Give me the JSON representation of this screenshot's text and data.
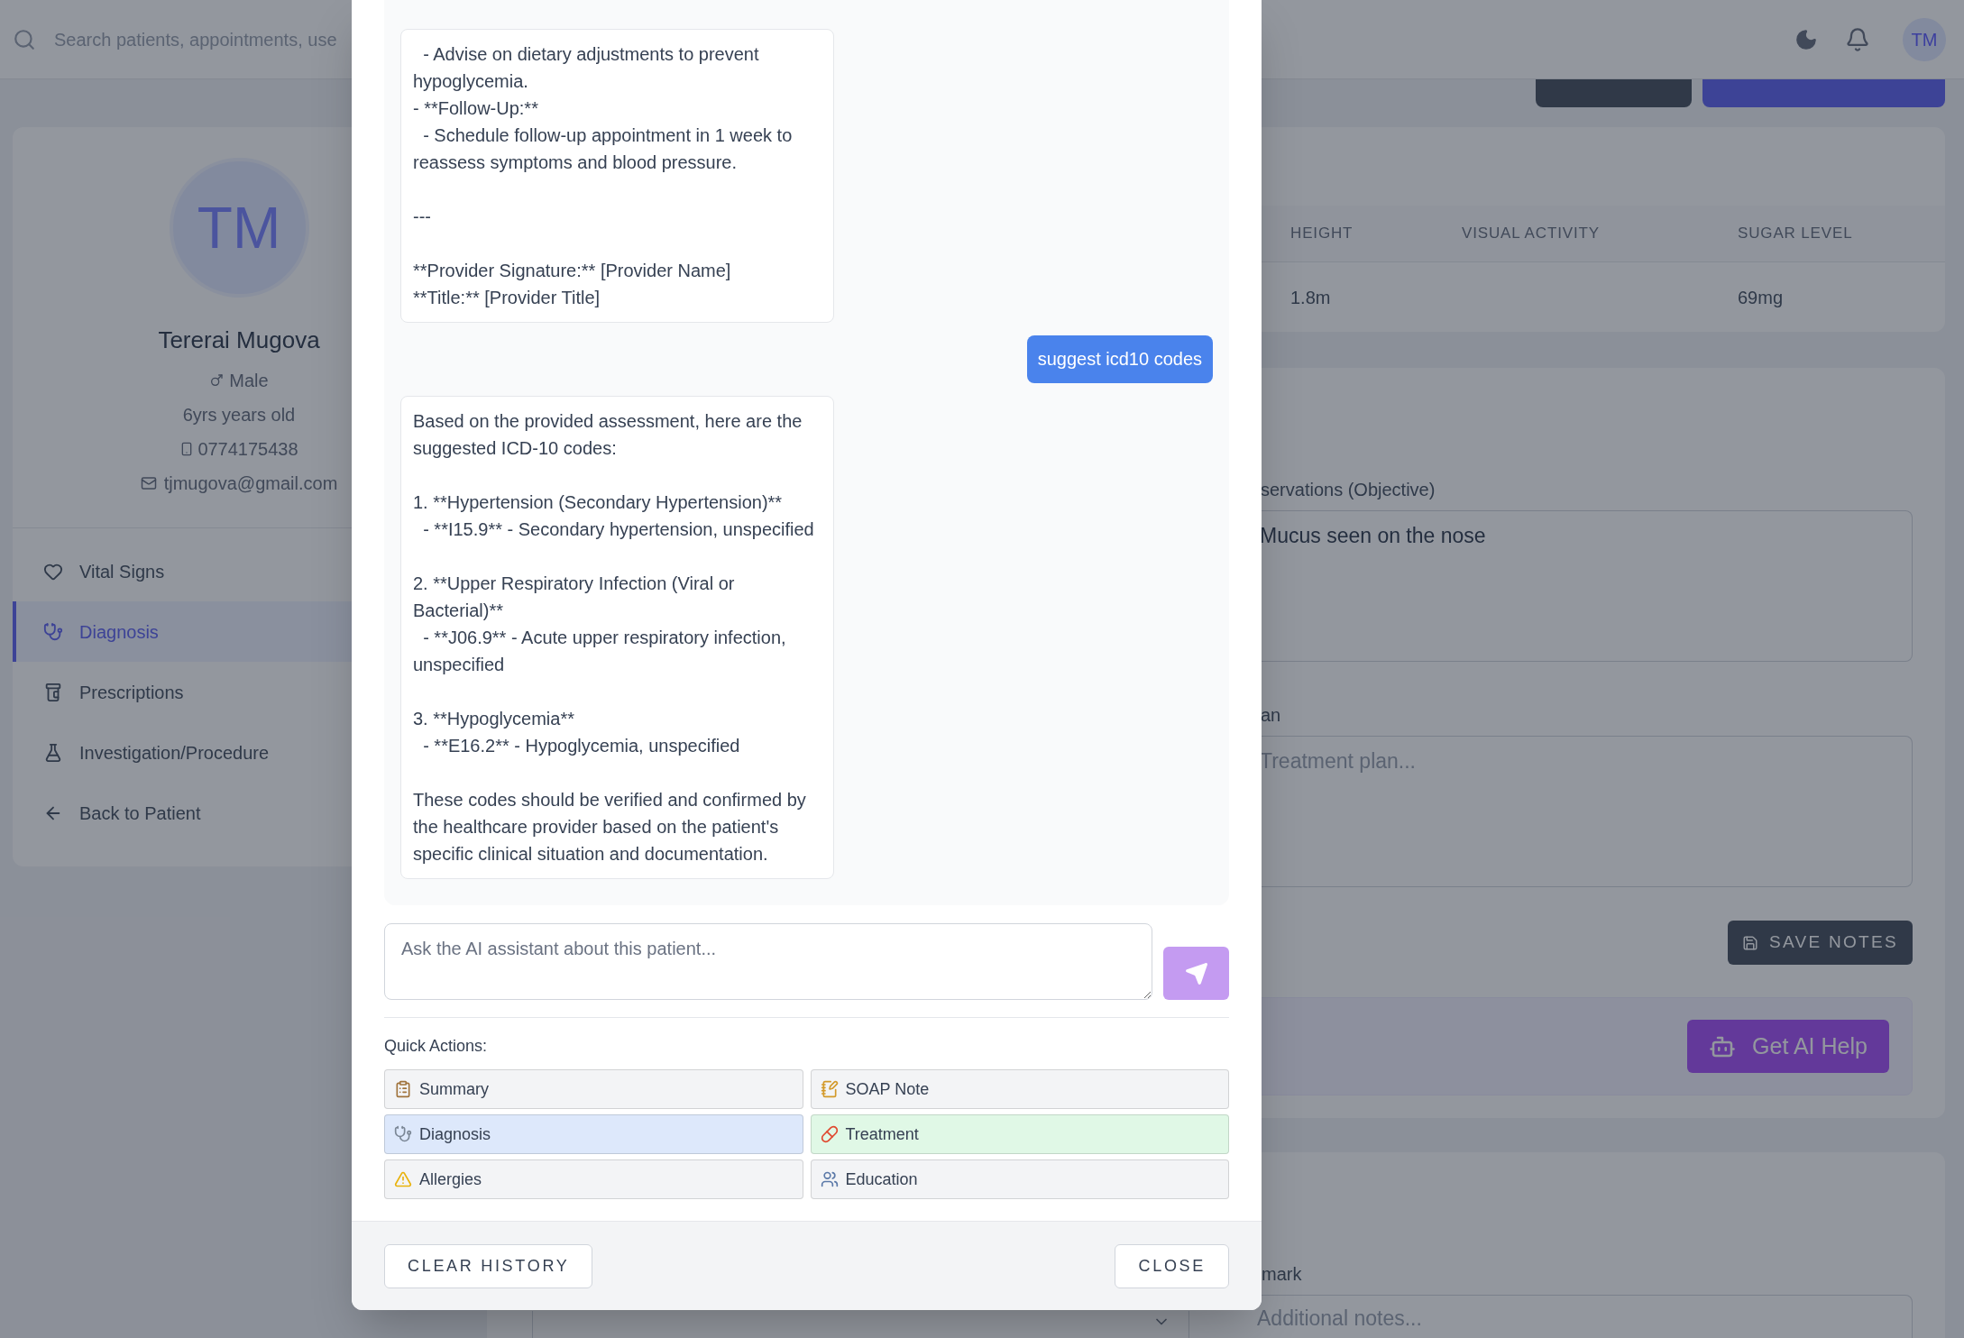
{
  "topbar": {
    "search": {
      "placeholder": "Search patients, appointments, use"
    },
    "avatar": "TM"
  },
  "header_buttons": [
    {
      "kind": "secondary"
    },
    {
      "kind": "primary"
    }
  ],
  "patient": {
    "initials": "TM",
    "name": "Tererai Mugova",
    "gender": "Male",
    "age": "6yrs years old",
    "phone": "0774175438",
    "email": "tjmugova@gmail.com"
  },
  "nav": [
    {
      "label": "Vital Signs",
      "selected": false
    },
    {
      "label": "Diagnosis",
      "selected": true
    },
    {
      "label": "Prescriptions",
      "selected": false
    },
    {
      "label": "Investigation/Procedure",
      "selected": false
    },
    {
      "label": "Back to Patient",
      "selected": false
    }
  ],
  "vitals": {
    "columns": [
      {
        "header": "HEIGHT",
        "value": "1.8m"
      },
      {
        "header": "VISUAL ACTIVITY"
      },
      {
        "header": "SUGAR LEVEL",
        "value": "69mg"
      }
    ]
  },
  "notes": {
    "observations": {
      "label": "servations (Objective)",
      "value": "Mucus seen on the nose"
    },
    "plan": {
      "label": "an",
      "placeholder": "Treatment plan..."
    },
    "save_button": "SAVE NOTES",
    "ai_button": "Get AI Help"
  },
  "remark": {
    "label": "mark",
    "placeholder": "Additional notes..."
  },
  "assistant_dialog": {
    "messages": [
      {
        "kind": "assistant",
        "text": "  - Advise on dietary adjustments to prevent hypoglycemia.\n- **Follow-Up:**\n  - Schedule follow-up appointment in 1 week to reassess symptoms and blood pressure.\n\n---\n\n**Provider Signature:** [Provider Name]\n**Title:** [Provider Title]"
      },
      {
        "kind": "user",
        "text": "suggest icd10 codes"
      },
      {
        "kind": "assistant",
        "text": "Based on the provided assessment, here are the suggested ICD-10 codes:\n\n1. **Hypertension (Secondary Hypertension)**\n  - **I15.9** - Secondary hypertension, unspecified\n\n2. **Upper Respiratory Infection (Viral or Bacterial)**\n  - **J06.9** - Acute upper respiratory infection, unspecified\n\n3. **Hypoglycemia**\n  - **E16.2** - Hypoglycemia, unspecified\n\nThese codes should be verified and confirmed by the healthcare provider based on the patient's specific clinical situation and documentation."
      }
    ],
    "input": {
      "placeholder": "Ask the AI assistant about this patient..."
    },
    "quick_actions_label": "Quick Actions:",
    "quick_actions": [
      {
        "label": "Summary",
        "color": "#f3f4f6"
      },
      {
        "label": "SOAP Note",
        "color": "#f3f4f6"
      },
      {
        "label": "Diagnosis",
        "color": "#dde8fb"
      },
      {
        "label": "Treatment",
        "color": "#e0f8e6"
      },
      {
        "label": "Allergies",
        "color": "#f3f4f6"
      },
      {
        "label": "Education",
        "color": "#f3f4f6"
      }
    ],
    "footer_buttons": [
      "CLEAR HISTORY",
      "CLOSE"
    ]
  }
}
